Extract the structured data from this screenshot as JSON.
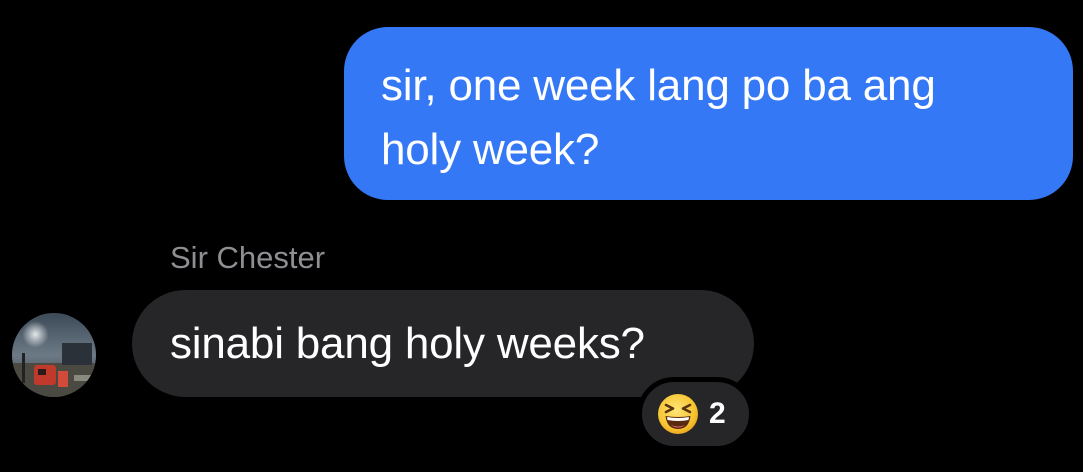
{
  "messages": [
    {
      "direction": "outgoing",
      "text": "sir, one week lang po ba ang\nholy week?"
    },
    {
      "direction": "incoming",
      "sender": "Sir Chester",
      "text": "sinabi bang holy weeks?",
      "reaction": {
        "emoji": "grinning-squinting-face-icon",
        "count": "2"
      }
    }
  ],
  "colors": {
    "background": "#000000",
    "outgoing_bubble": "#3478F6",
    "incoming_bubble": "#262628",
    "sender_name": "#8E8E93"
  }
}
